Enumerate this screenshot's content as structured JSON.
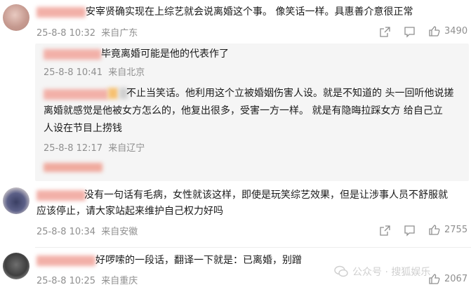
{
  "comments": [
    {
      "text": "安宰贤确实现在上综艺就会说离婚这个事。 像笑话一样。具惠善介意很正常",
      "time": "25-8-8 10:32",
      "location": "来自广东",
      "likes": "3490"
    },
    {
      "text_line1": "没有一句话有毛病，女性就该这样，即使是玩笑综艺效果，但是让涉事人员不舒服就",
      "text_line2": "应该停止，请大家站起来维护自己权力好吗",
      "time": "25-8-8 10:34",
      "location": "来自安徽",
      "likes": "2755"
    },
    {
      "text": "好啰嗦的一段话，翻译一下就是：已离婚，别蹭",
      "time": "25-8-8 10:25",
      "location": "来自重庆",
      "likes": "2067"
    }
  ],
  "replies": [
    {
      "text": "毕竟离婚可能是他的代表作了",
      "time": "25-8-8 10:41",
      "location": "来自北京"
    },
    {
      "line1": "不止当笑话。他利用这个立被婚姻伤害人设。就是不知道的 头一回听他说搓",
      "line2": "离婚就感觉是他被女方怎么的，他复出很多，受害一方一样。 就是有隐晦拉踩女方 给自己立",
      "line3": "人设在节目上捞钱",
      "time": "25-8-8 12:17",
      "location": "来自辽宁"
    }
  ],
  "watermark": "公众号 · 搜狐娱乐",
  "icons": [
    "share-icon",
    "comment-icon",
    "like-icon"
  ],
  "colors": {
    "meta": "#8f8f8f",
    "reply_bg": "#f5f5f5",
    "blur_name": "#f2b0a8"
  }
}
